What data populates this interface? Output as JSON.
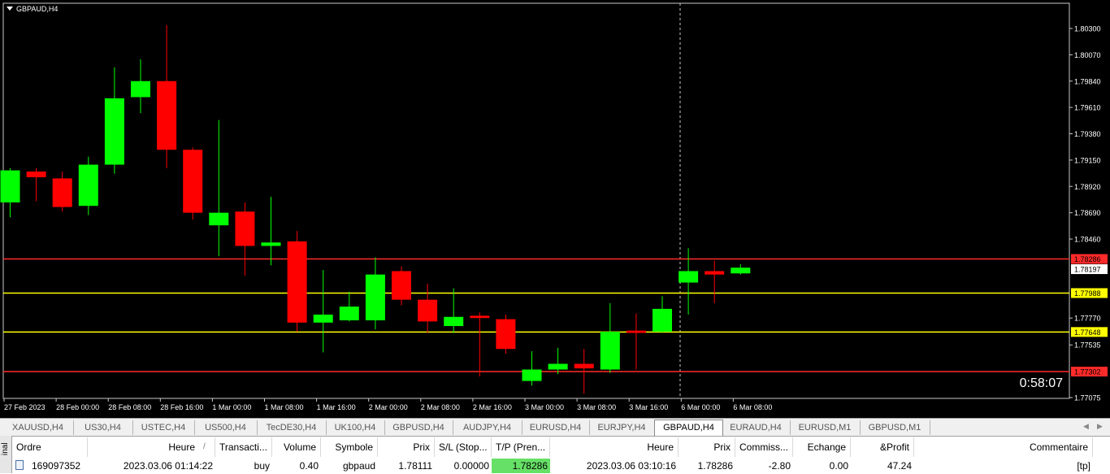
{
  "chart": {
    "title": "GBPAUD,H4",
    "timer": "0:58:07",
    "price_min": 1.7695,
    "price_max": 1.8044,
    "price_labels": [
      "1.80300",
      "1.80070",
      "1.79840",
      "1.79610",
      "1.79380",
      "1.79150",
      "1.78920",
      "1.78690",
      "1.78460",
      "1.77770",
      "1.77535",
      "1.77075"
    ],
    "time_labels": [
      "27 Feb 2023",
      "28 Feb 00:00",
      "28 Feb 08:00",
      "28 Feb 16:00",
      "1 Mar 00:00",
      "1 Mar 08:00",
      "1 Mar 16:00",
      "2 Mar 00:00",
      "2 Mar 08:00",
      "2 Mar 16:00",
      "3 Mar 00:00",
      "3 Mar 08:00",
      "3 Mar 16:00",
      "6 Mar 00:00",
      "6 Mar 08:00"
    ],
    "hlines": [
      {
        "price": 1.78286,
        "color": "#ff2a2a",
        "label": "1.78286"
      },
      {
        "price": 1.77988,
        "color": "#ffff00",
        "label": "1.77988"
      },
      {
        "price": 1.77648,
        "color": "#ffff00",
        "label": "1.77648"
      },
      {
        "price": 1.77302,
        "color": "#ff2a2a",
        "label": "1.77302"
      }
    ],
    "current_price": "1.78197",
    "current_price_value": 1.78197,
    "colors": {
      "bull": "#00ff00",
      "bear": "#ff0000",
      "background": "#000000",
      "text": "#ffffff"
    }
  },
  "chart_data": {
    "type": "candlestick",
    "symbol": "GBPAUD",
    "timeframe": "H4",
    "candles": [
      {
        "o": 1.7878,
        "h": 1.7908,
        "l": 1.7865,
        "c": 1.7906
      },
      {
        "o": 1.7905,
        "h": 1.7908,
        "l": 1.7879,
        "c": 1.79
      },
      {
        "o": 1.7899,
        "h": 1.7905,
        "l": 1.787,
        "c": 1.7874
      },
      {
        "o": 1.7875,
        "h": 1.7918,
        "l": 1.7867,
        "c": 1.7911
      },
      {
        "o": 1.7911,
        "h": 1.7996,
        "l": 1.7903,
        "c": 1.7969
      },
      {
        "o": 1.797,
        "h": 1.8003,
        "l": 1.7956,
        "c": 1.7984
      },
      {
        "o": 1.7984,
        "h": 1.8033,
        "l": 1.7908,
        "c": 1.7924
      },
      {
        "o": 1.7924,
        "h": 1.7926,
        "l": 1.7863,
        "c": 1.7869
      },
      {
        "o": 1.7858,
        "h": 1.795,
        "l": 1.7831,
        "c": 1.7869
      },
      {
        "o": 1.787,
        "h": 1.7878,
        "l": 1.7814,
        "c": 1.784
      },
      {
        "o": 1.784,
        "h": 1.7883,
        "l": 1.7823,
        "c": 1.7843
      },
      {
        "o": 1.7844,
        "h": 1.7853,
        "l": 1.7765,
        "c": 1.7773
      },
      {
        "o": 1.7773,
        "h": 1.7819,
        "l": 1.7747,
        "c": 1.778
      },
      {
        "o": 1.7775,
        "h": 1.78,
        "l": 1.7774,
        "c": 1.7787
      },
      {
        "o": 1.7775,
        "h": 1.783,
        "l": 1.7767,
        "c": 1.7815
      },
      {
        "o": 1.7818,
        "h": 1.7822,
        "l": 1.7788,
        "c": 1.7793
      },
      {
        "o": 1.7793,
        "h": 1.7807,
        "l": 1.7764,
        "c": 1.7774
      },
      {
        "o": 1.777,
        "h": 1.7803,
        "l": 1.7764,
        "c": 1.7778
      },
      {
        "o": 1.7779,
        "h": 1.7782,
        "l": 1.7726,
        "c": 1.7777
      },
      {
        "o": 1.7776,
        "h": 1.778,
        "l": 1.7746,
        "c": 1.775
      },
      {
        "o": 1.7722,
        "h": 1.7748,
        "l": 1.7718,
        "c": 1.7732
      },
      {
        "o": 1.7732,
        "h": 1.7751,
        "l": 1.7728,
        "c": 1.7737
      },
      {
        "o": 1.7737,
        "h": 1.775,
        "l": 1.7711,
        "c": 1.7733
      },
      {
        "o": 1.7732,
        "h": 1.779,
        "l": 1.7729,
        "c": 1.7765
      },
      {
        "o": 1.7766,
        "h": 1.7781,
        "l": 1.7732,
        "c": 1.7764
      },
      {
        "o": 1.7765,
        "h": 1.7796,
        "l": 1.7764,
        "c": 1.7785
      },
      {
        "o": 1.7808,
        "h": 1.7838,
        "l": 1.778,
        "c": 1.7818
      },
      {
        "o": 1.7818,
        "h": 1.7827,
        "l": 1.779,
        "c": 1.7815
      },
      {
        "o": 1.7816,
        "h": 1.7824,
        "l": 1.7815,
        "c": 1.7821
      }
    ]
  },
  "tabs": [
    "XAUUSD,H4",
    "US30,H4",
    "USTEC,H4",
    "US500,H4",
    "TecDE30,H4",
    "UK100,H4",
    "GBPUSD,H4",
    "AUDJPY,H4",
    "EURUSD,H4",
    "EURJPY,H4",
    "GBPAUD,H4",
    "EURAUD,H4",
    "EURUSD,M1",
    "GBPUSD,M1"
  ],
  "active_tab": "GBPAUD,H4",
  "terminal": {
    "side_label": "inal",
    "columns": [
      "Ordre",
      "Heure",
      "Transacti...",
      "Volume",
      "Symbole",
      "Prix",
      "S/L (Stop...",
      "T/P (Pren...",
      "Heure",
      "Prix",
      "Commiss...",
      "Echange",
      "&Profit",
      "Commentaire"
    ],
    "sort_indicator": "/",
    "row": {
      "ordre": "169097352",
      "heure": "2023.03.06 01:14:22",
      "transaction": "buy",
      "volume": "0.40",
      "symbole": "gbpaud",
      "prix": "1.78111",
      "sl": "0.00000",
      "tp": "1.78286",
      "heure2": "2023.03.06 03:10:16",
      "prix2": "1.78286",
      "commission": "-2.80",
      "echange": "0.00",
      "profit": "47.24",
      "commentaire": "[tp]"
    }
  }
}
